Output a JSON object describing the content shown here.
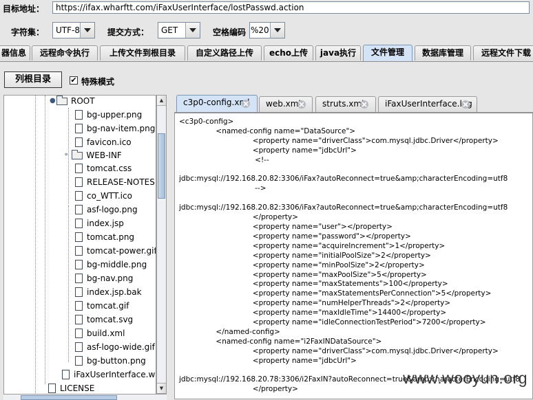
{
  "top": {
    "url_label": "目标地址：",
    "url_value": "https://ifax.wharftt.com/iFaxUserInterface/lostPasswd.action",
    "charset_label": "字符集：",
    "charset_value": "UTF-8",
    "method_label": "提交方式：",
    "method_value": "GET",
    "space_label": "空格编码",
    "space_value": "%20"
  },
  "tabs": [
    {
      "label": "器信息"
    },
    {
      "label": "远程命令执行"
    },
    {
      "label": "上传文件到根目录"
    },
    {
      "label": "自定义路径上传"
    },
    {
      "label": "echo上传"
    },
    {
      "label": "java执行"
    },
    {
      "label": "文件管理",
      "active": true
    },
    {
      "label": "数据库管理"
    },
    {
      "label": "远程文件下载"
    }
  ],
  "toolbar": {
    "list_root_label": "列根目录",
    "special_mode_label": "特殊模式",
    "special_mode_checked": "✔"
  },
  "tree": {
    "root_folder": "ROOT",
    "files": [
      "bg-upper.png",
      "bg-nav-item.png",
      "favicon.ico"
    ],
    "webinf_folder": "WEB-INF",
    "files2": [
      "tomcat.css",
      "RELEASE-NOTES",
      "co_WTT.ico",
      "asf-logo.png",
      "index.jsp",
      "tomcat.png",
      "tomcat-power.gif",
      "bg-middle.png",
      "bg-nav.png",
      "index.jsp.bak",
      "tomcat.gif",
      "tomcat.svg",
      "build.xml",
      "asf-logo-wide.gif",
      "bg-button.png"
    ],
    "war_file": "iFaxUserInterface.war",
    "license": "LICENSE"
  },
  "editor": {
    "tabs": [
      {
        "label": "c3p0-config.xml",
        "active": true
      },
      {
        "label": "web.xml"
      },
      {
        "label": "struts.xml"
      },
      {
        "label": "iFaxUserInterface.log"
      }
    ],
    "lines": [
      "<c3p0-config>",
      "                <named-config name=\"DataSource\">",
      "                                <property name=\"driverClass\">com.mysql.jdbc.Driver</property>",
      "                                <property name=\"jdbcUrl\">",
      "                                 <!--",
      "",
      "jdbc:mysql://192.168.20.82:3306/iFax?autoReconnect=true&amp;characterEncoding=utf8",
      "                                 -->",
      "",
      "jdbc:mysql://192.168.20.82:3306/iFax?autoReconnect=true&amp;characterEncoding=utf8",
      "                                </property>",
      "                                <property name=\"user\"></property>",
      "                                <property name=\"password\"></property>",
      "                                <property name=\"acquireIncrement\">1</property>",
      "                                <property name=\"initialPoolSize\">2</property>",
      "                                <property name=\"minPoolSize\">2</property>",
      "                                <property name=\"maxPoolSize\">5</property>",
      "                                <property name=\"maxStatements\">100</property>",
      "                                <property name=\"maxStatementsPerConnection\">5</property>",
      "                                <property name=\"numHelperThreads\">2</property>",
      "                                <property name=\"maxIdleTime\">14400</property>",
      "                                <property name=\"idleConnectionTestPeriod\">7200</property>",
      "                </named-config>",
      "                <named-config name=\"i2FaxINDataSource\">",
      "                                <property name=\"driverClass\">com.mysql.jdbc.Driver</property>",
      "                                <property name=\"jdbcUrl\">",
      "",
      "jdbc:mysql://192.168.20.78:3306/i2FaxIN?autoReconnect=true&amp;characterEncoding=utf8",
      "                                </property>"
    ]
  },
  "watermark": "www.wooyun.org"
}
